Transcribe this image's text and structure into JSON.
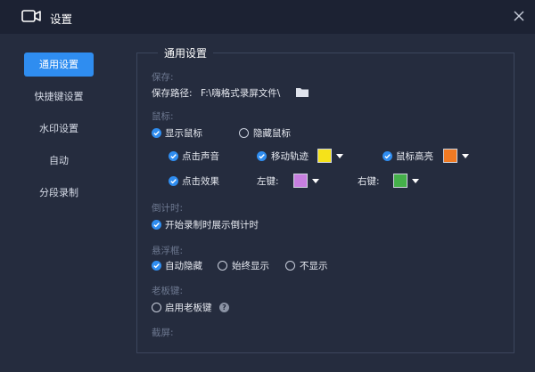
{
  "window": {
    "title": "设置",
    "icon": "video-camera-icon",
    "close_icon": "close-icon"
  },
  "sidebar": {
    "items": [
      {
        "label": "通用设置",
        "active": true
      },
      {
        "label": "快捷键设置",
        "active": false
      },
      {
        "label": "水印设置",
        "active": false
      },
      {
        "label": "自动",
        "active": false
      },
      {
        "label": "分段录制",
        "active": false
      }
    ]
  },
  "panel": {
    "title": "通用设置",
    "save": {
      "section_label": "保存:",
      "path_label": "保存路径:",
      "path_value": "F:\\嗨格式录屏文件\\",
      "folder_icon": "folder-icon"
    },
    "mouse": {
      "section_label": "鼠标:",
      "show_cursor": {
        "label": "显示鼠标",
        "checked": true
      },
      "hide_cursor": {
        "label": "隐藏鼠标",
        "checked": false
      },
      "click_sound": {
        "label": "点击声音",
        "checked": true
      },
      "move_track": {
        "label": "移动轨迹",
        "checked": true,
        "color": "#f5e21a"
      },
      "cursor_highlight": {
        "label": "鼠标高亮",
        "checked": true,
        "color": "#f07a23"
      },
      "click_effect": {
        "label": "点击效果",
        "checked": true
      },
      "left_key": {
        "label": "左键:",
        "color": "#c77fe0"
      },
      "right_key": {
        "label": "右键:",
        "color": "#45b04a"
      }
    },
    "countdown": {
      "section_label": "倒计时:",
      "show_countdown": {
        "label": "开始录制时展示倒计时",
        "checked": true
      }
    },
    "floating": {
      "section_label": "悬浮框:",
      "options": [
        {
          "label": "自动隐藏",
          "checked": true
        },
        {
          "label": "始终显示",
          "checked": false
        },
        {
          "label": "不显示",
          "checked": false
        }
      ]
    },
    "boss_key": {
      "section_label": "老板键:",
      "enable": {
        "label": "启用老板键",
        "checked": false
      },
      "help_icon": "help-icon"
    },
    "screenshot": {
      "section_label": "截屏:"
    }
  },
  "colors": {
    "accent": "#2f8df0",
    "background": "#252c3e",
    "titlebar": "#1c2233"
  }
}
